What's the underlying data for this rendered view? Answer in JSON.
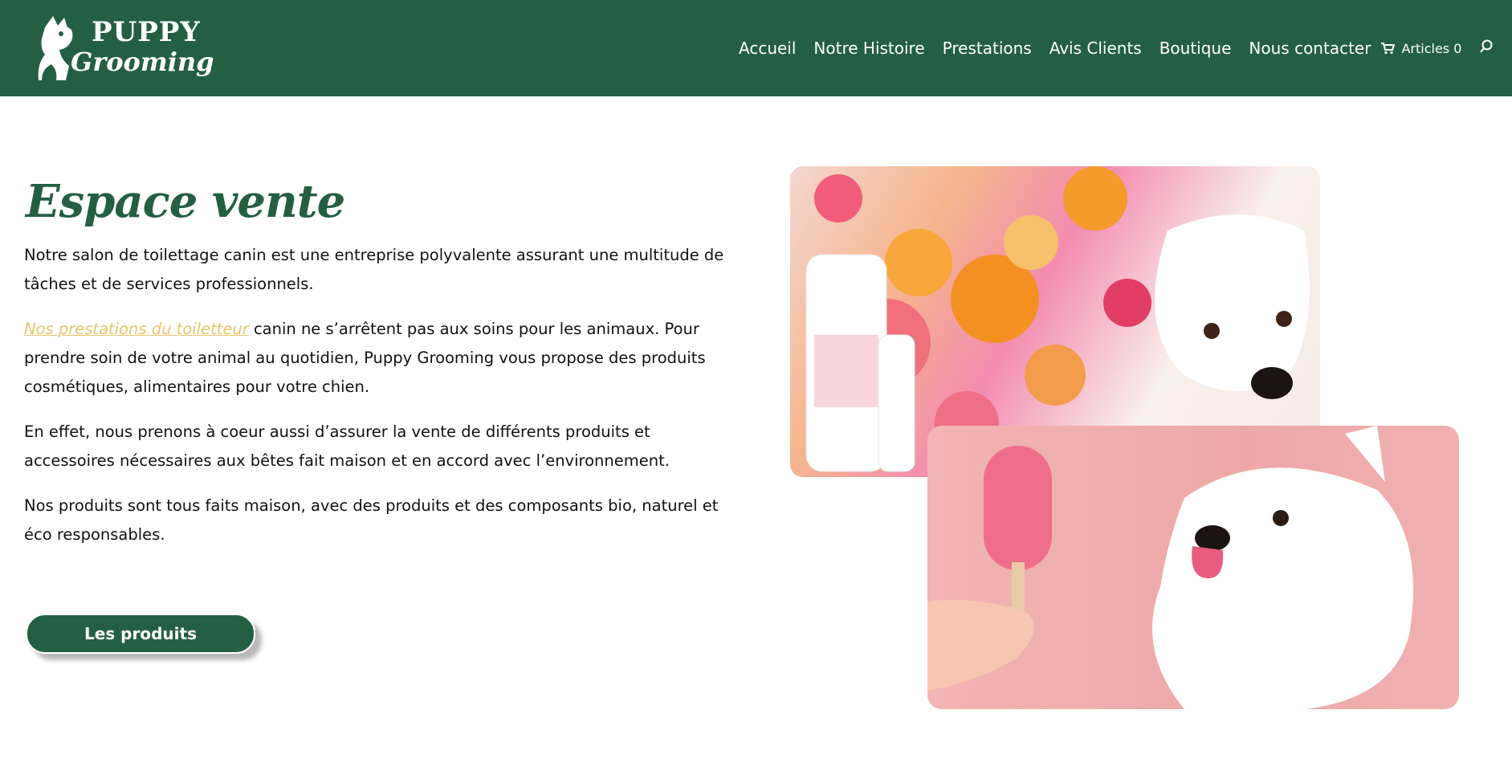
{
  "header": {
    "logo_text_1": "PUPPY",
    "logo_text_2": "Grooming",
    "nav": [
      {
        "label": "Accueil"
      },
      {
        "label": "Notre Histoire"
      },
      {
        "label": "Prestations"
      },
      {
        "label": "Avis Clients"
      },
      {
        "label": "Boutique"
      },
      {
        "label": "Nous contacter"
      }
    ],
    "cart_label": "Articles 0",
    "icons": {
      "cart": "cart-icon",
      "search": "search-icon"
    }
  },
  "main": {
    "title": "Espace vente",
    "paragraph_1": "Notre salon de toilettage canin est une entreprise polyvalente assurant une multitude de tâches et de services professionnels.",
    "paragraph_2_link": "Nos prestations du toiletteur",
    "paragraph_2_rest": " canin ne s’arrêtent pas aux soins pour les animaux. Pour prendre soin de votre animal au quotidien, Puppy Grooming vous propose des produits cosmétiques, alimentaires pour votre chien.",
    "paragraph_3": "En effet, nous prenons à coeur aussi d’assurer la vente de différents produits et accessoires nécessaires aux bêtes fait maison et en accord avec l’environnement.",
    "paragraph_4": "Nos produits sont tous faits maison, avec des produits et des composants bio, naturel et éco responsables.",
    "button_label": "Les produits"
  },
  "colors": {
    "brand_green": "#245f43",
    "link_yellow": "#e8c46b"
  }
}
